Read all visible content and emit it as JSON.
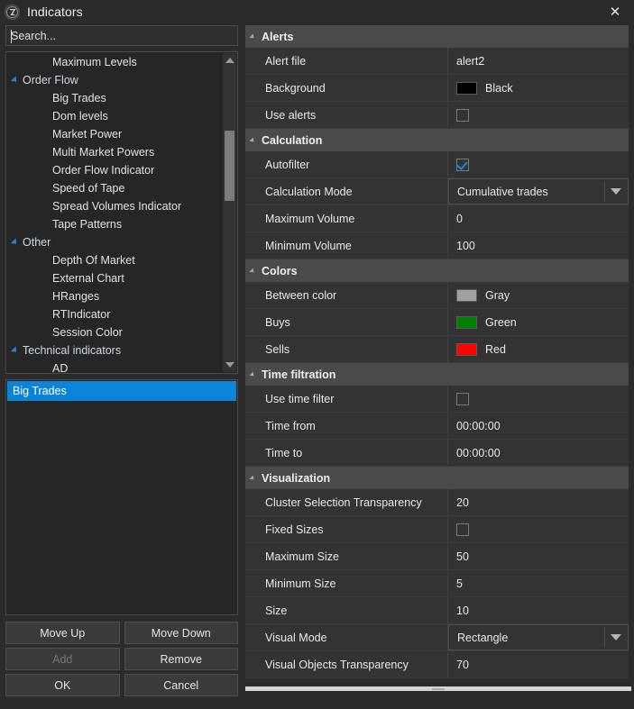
{
  "window": {
    "title": "Indicators",
    "app_icon": "app-logo-icon",
    "close_label": "✕"
  },
  "search": {
    "placeholder": "Search...",
    "value": ""
  },
  "tree": {
    "items": [
      {
        "label": "Maximum Levels",
        "type": "leaf"
      },
      {
        "label": "Order Flow",
        "type": "group"
      },
      {
        "label": "Big Trades",
        "type": "leaf"
      },
      {
        "label": "Dom levels",
        "type": "leaf"
      },
      {
        "label": "Market Power",
        "type": "leaf"
      },
      {
        "label": "Multi Market Powers",
        "type": "leaf"
      },
      {
        "label": "Order Flow Indicator",
        "type": "leaf"
      },
      {
        "label": "Speed of Tape",
        "type": "leaf"
      },
      {
        "label": "Spread Volumes Indicator",
        "type": "leaf"
      },
      {
        "label": "Tape Patterns",
        "type": "leaf"
      },
      {
        "label": "Other",
        "type": "group"
      },
      {
        "label": "Depth Of Market",
        "type": "leaf"
      },
      {
        "label": "External Chart",
        "type": "leaf"
      },
      {
        "label": "HRanges",
        "type": "leaf"
      },
      {
        "label": "RTIndicator",
        "type": "leaf"
      },
      {
        "label": "Session Color",
        "type": "leaf"
      },
      {
        "label": "Technical indicators",
        "type": "group"
      },
      {
        "label": "AD",
        "type": "leaf"
      }
    ]
  },
  "selected_list": {
    "items": [
      {
        "label": "Big Trades",
        "selected": true
      }
    ]
  },
  "buttons": {
    "move_up": "Move Up",
    "move_down": "Move Down",
    "add": "Add",
    "add_disabled": true,
    "remove": "Remove",
    "ok": "OK",
    "cancel": "Cancel"
  },
  "properties": {
    "sections": [
      {
        "title": "Alerts",
        "rows": [
          {
            "name": "Alert file",
            "kind": "text",
            "value": "alert2"
          },
          {
            "name": "Background",
            "kind": "color",
            "value": "Black",
            "color": "#000000"
          },
          {
            "name": "Use alerts",
            "kind": "checkbox",
            "checked": false
          }
        ]
      },
      {
        "title": "Calculation",
        "rows": [
          {
            "name": "Autofilter",
            "kind": "checkbox",
            "checked": true
          },
          {
            "name": "Calculation Mode",
            "kind": "combo",
            "value": "Cumulative trades"
          },
          {
            "name": "Maximum Volume",
            "kind": "text",
            "value": "0"
          },
          {
            "name": "Minimum Volume",
            "kind": "text",
            "value": "100"
          }
        ]
      },
      {
        "title": "Colors",
        "rows": [
          {
            "name": "Between color",
            "kind": "color",
            "value": "Gray",
            "color": "#a0a0a0"
          },
          {
            "name": "Buys",
            "kind": "color",
            "value": "Green",
            "color": "#008000"
          },
          {
            "name": "Sells",
            "kind": "color",
            "value": "Red",
            "color": "#ff0000"
          }
        ]
      },
      {
        "title": "Time filtration",
        "rows": [
          {
            "name": "Use time filter",
            "kind": "checkbox",
            "checked": false
          },
          {
            "name": "Time from",
            "kind": "text",
            "value": "00:00:00"
          },
          {
            "name": "Time to",
            "kind": "text",
            "value": "00:00:00"
          }
        ]
      },
      {
        "title": "Visualization",
        "rows": [
          {
            "name": "Cluster Selection Transparency",
            "kind": "text",
            "value": "20"
          },
          {
            "name": "Fixed Sizes",
            "kind": "checkbox",
            "checked": false
          },
          {
            "name": "Maximum Size",
            "kind": "text",
            "value": "50"
          },
          {
            "name": "Minimum Size",
            "kind": "text",
            "value": "5"
          },
          {
            "name": "Size",
            "kind": "text",
            "value": "10"
          },
          {
            "name": "Visual Mode",
            "kind": "combo",
            "value": "Rectangle"
          },
          {
            "name": "Visual Objects Transparency",
            "kind": "text",
            "value": "70"
          }
        ]
      }
    ]
  }
}
